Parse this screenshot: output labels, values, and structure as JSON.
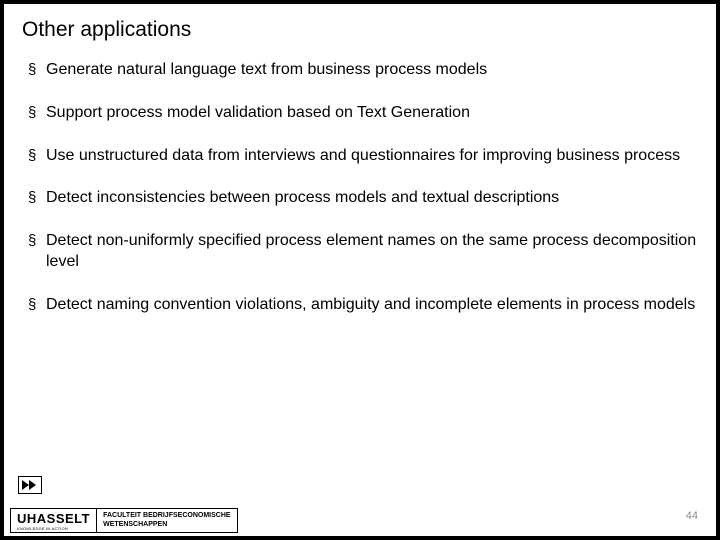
{
  "slide": {
    "title": "Other applications",
    "bullets": [
      "Generate natural language text from business process models",
      "Support process model validation based on Text Generation",
      "Use unstructured data from interviews and questionnaires for improving business process",
      "Detect inconsistencies between process models and textual descriptions",
      "Detect non-uniformly specified process element names on the same process decomposition level",
      "Detect naming convention violations, ambiguity and incomplete elements in process models"
    ]
  },
  "footer": {
    "logo_main": "UHASSELT",
    "logo_tag": "KNOWLEDGE IN ACTION",
    "faculty_line1": "FACULTEIT BEDRIJFSECONOMISCHE",
    "faculty_line2": "WETENSCHAPPEN",
    "page_number": "44"
  }
}
